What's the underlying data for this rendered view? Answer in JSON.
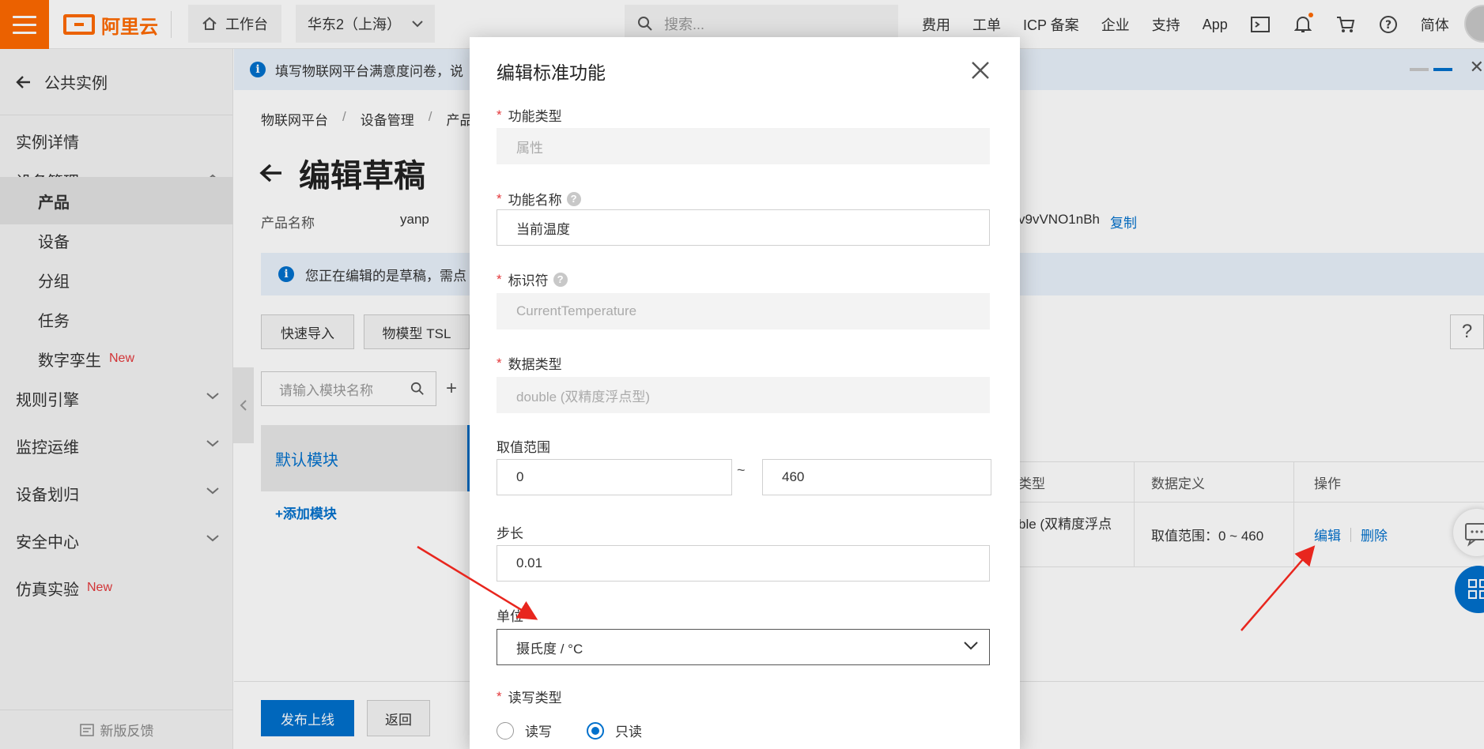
{
  "topbar": {
    "logo_text": "阿里云",
    "workbench": "工作台",
    "region": "华东2（上海）",
    "search_placeholder": "搜索...",
    "nav": [
      "费用",
      "工单",
      "ICP 备案",
      "企业",
      "支持",
      "App"
    ],
    "lang": "简体"
  },
  "sidebar": {
    "back_label": "公共实例",
    "items": [
      {
        "label": "实例详情"
      },
      {
        "label": "设备管理"
      },
      {
        "label": "产品"
      },
      {
        "label": "设备"
      },
      {
        "label": "分组"
      },
      {
        "label": "任务"
      },
      {
        "label": "数字孪生",
        "tag": "New"
      },
      {
        "label": "规则引擎"
      },
      {
        "label": "监控运维"
      },
      {
        "label": "设备划归"
      },
      {
        "label": "安全中心"
      },
      {
        "label": "仿真实验",
        "tag": "New"
      }
    ],
    "feedback": "新版反馈"
  },
  "notice": {
    "text": "填写物联网平台满意度问卷，说"
  },
  "breadcrumb": [
    "物联网平台",
    "设备管理",
    "产品"
  ],
  "page": {
    "title": "编辑草稿",
    "product_name_label": "产品名称",
    "product_name_value": "yanp",
    "product_key_partial": "v9vVNO1nBh",
    "copy_label": "复制",
    "draft_notice": "您正在编辑的是草稿，需点",
    "quick_import": "快速导入",
    "tsl_button": "物模型 TSL",
    "module_search_placeholder": "请输入模块名称",
    "default_module": "默认模块",
    "add_module": "+添加模块",
    "publish_button": "发布上线",
    "back_button": "返回"
  },
  "table": {
    "headers": [
      "类型",
      "数据定义",
      "操作"
    ],
    "row": {
      "data_type": "ble (双精度浮点",
      "definition": "取值范围：0 ~ 460",
      "edit": "编辑",
      "delete": "删除"
    }
  },
  "modal": {
    "title": "编辑标准功能",
    "function_type_label": "功能类型",
    "function_type_value": "属性",
    "function_name_label": "功能名称",
    "function_name_value": "当前温度",
    "identifier_label": "标识符",
    "identifier_value": "CurrentTemperature",
    "data_type_label": "数据类型",
    "data_type_value": "double (双精度浮点型)",
    "range_label": "取值范围",
    "range_min": "0",
    "range_tilde": "~",
    "range_max": "460",
    "step_label": "步长",
    "step_value": "0.01",
    "unit_label": "单位",
    "unit_value": "摄氏度 / °C",
    "rw_label": "读写类型",
    "rw_options": [
      "读写",
      "只读"
    ],
    "rw_selected": "只读"
  },
  "colors": {
    "accent": "#0070cc",
    "brand": "#ff6a00",
    "required": "#e4393c",
    "annotation_arrow": "#e8261e"
  }
}
